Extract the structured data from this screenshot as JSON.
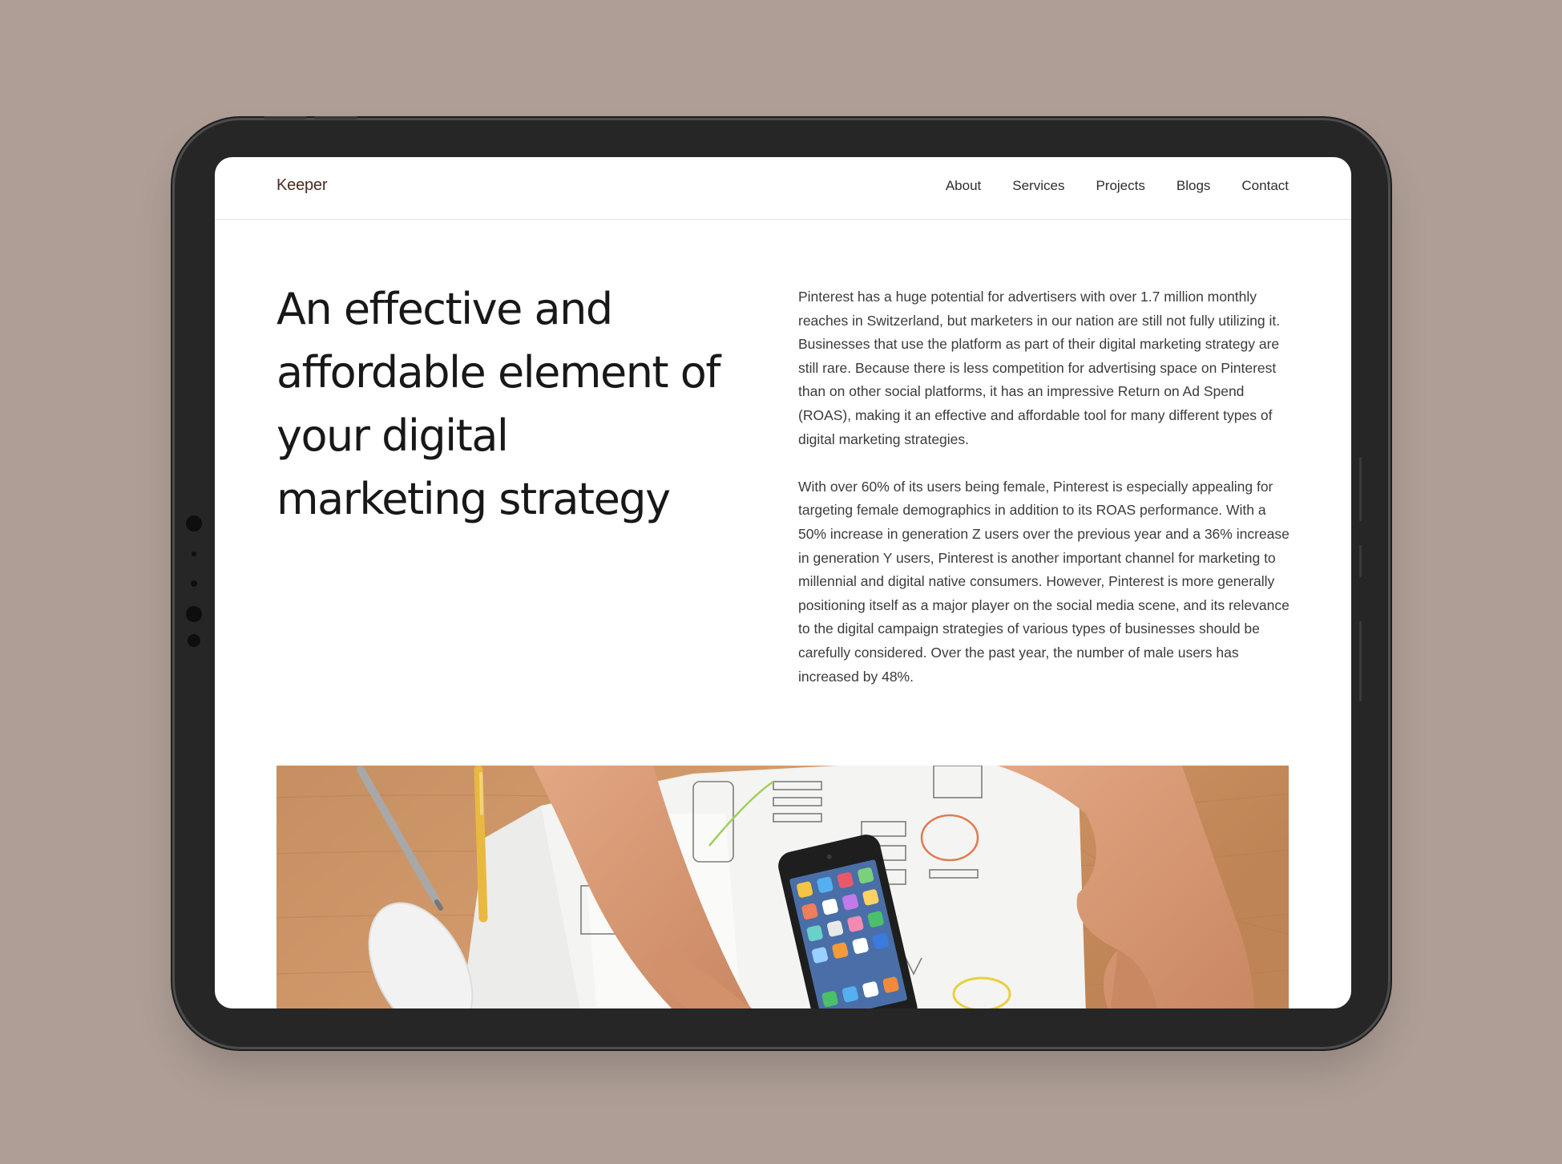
{
  "colors": {
    "background": "#ae9e96",
    "device_frame": "#262626",
    "screen": "#ffffff",
    "brand": "#4a2b22",
    "heading": "#181818",
    "body_text": "#3b3b3b"
  },
  "header": {
    "brand": "Keeper",
    "nav": [
      {
        "label": "About"
      },
      {
        "label": "Services"
      },
      {
        "label": "Projects"
      },
      {
        "label": "Blogs"
      },
      {
        "label": "Contact"
      }
    ]
  },
  "hero": {
    "headline": "An effective and affordable element of your digital marketing strategy",
    "paragraphs": [
      "Pinterest has a huge potential for advertisers with over 1.7 million monthly reaches in Switzerland, but marketers in our nation are still not fully utilizing it. Businesses that use the platform as part of their digital marketing strategy are still rare. Because there is less competition for advertising space on Pinterest than on other social platforms, it has an impressive Return on Ad Spend (ROAS), making it an effective and affordable tool for many different types of digital marketing strategies.",
      "With over 60% of its users being female, Pinterest is especially appealing for targeting female demographics in addition to its ROAS performance. With a 50% increase in generation Z users over the previous year and a 36% increase in generation Y users, Pinterest is another important channel for marketing to millennial and digital native consumers. However, Pinterest is more generally positioning itself as a major player on the social media scene, and its relevance to the digital campaign strategies of various types of businesses should be carefully considered. Over the past year, the number of male users has increased by 48%."
    ]
  },
  "image": {
    "subject": "desk-with-smartphone-and-wireframe-sketches"
  }
}
